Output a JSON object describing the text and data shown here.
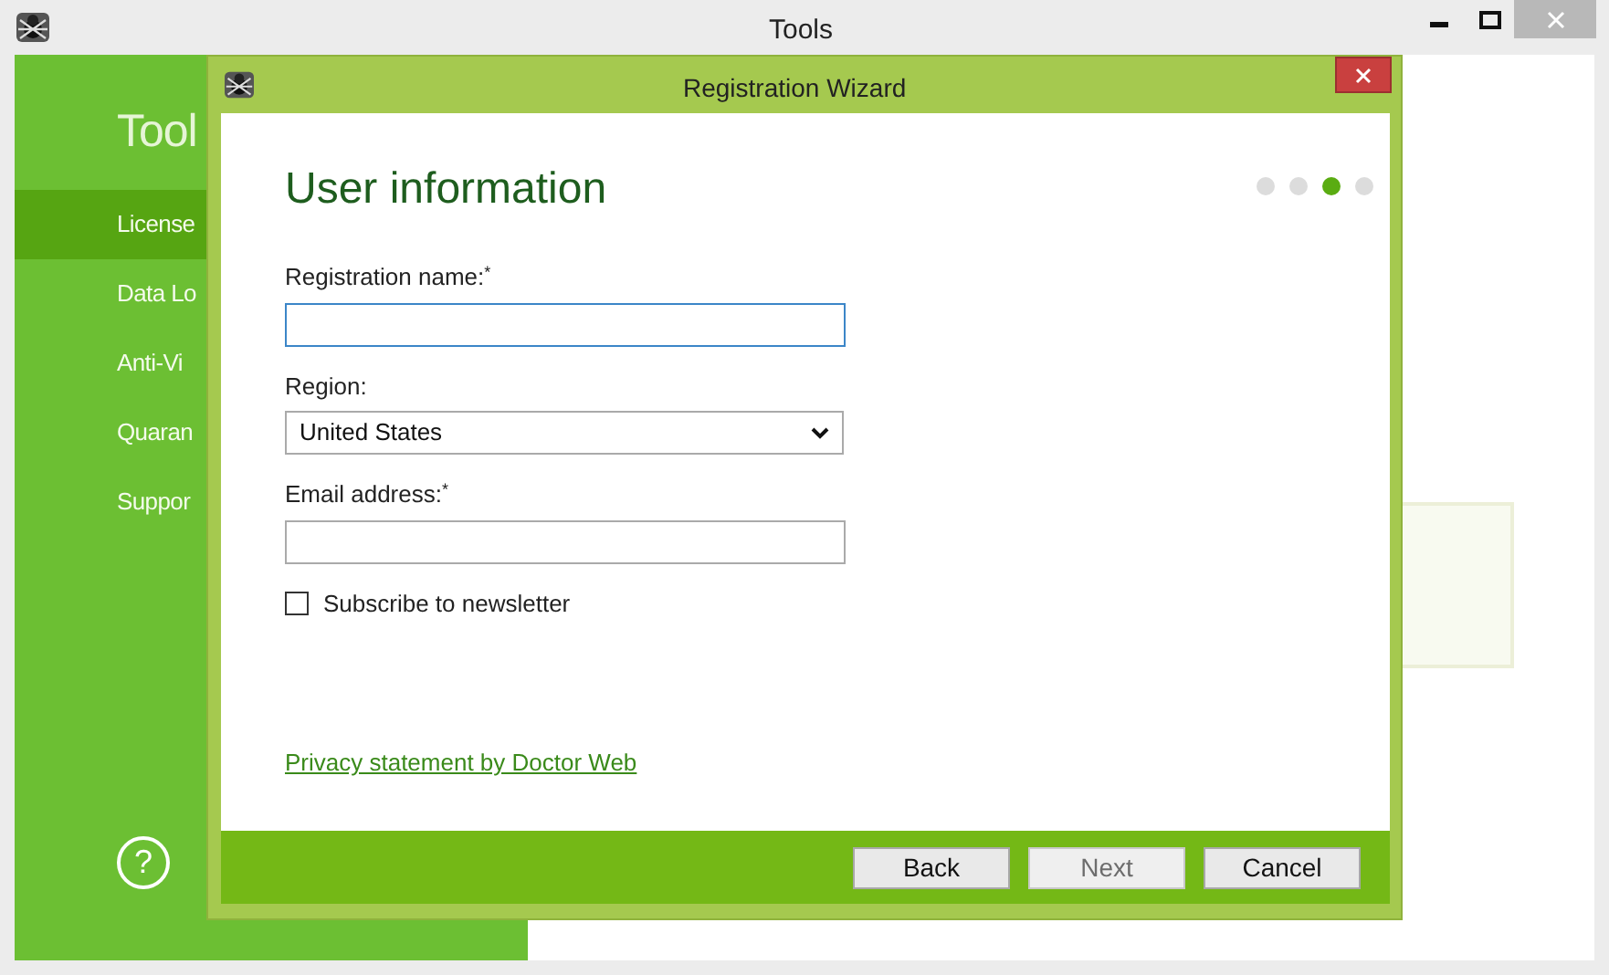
{
  "window": {
    "title": "Tools"
  },
  "sidebar": {
    "title": "Tool",
    "items": [
      {
        "label": "License",
        "selected": true
      },
      {
        "label": "Data Lo",
        "selected": false
      },
      {
        "label": "Anti-Vi",
        "selected": false
      },
      {
        "label": "Quaran",
        "selected": false
      },
      {
        "label": "Suppor",
        "selected": false
      }
    ],
    "help": "?"
  },
  "dialog": {
    "title": "Registration Wizard",
    "heading": "User information",
    "steps": [
      {
        "selected": false
      },
      {
        "selected": false
      },
      {
        "selected": true
      },
      {
        "selected": false
      }
    ],
    "fields": [
      {
        "kind": "text",
        "label": "Registration name:$^{*}$",
        "focused": true
      },
      {
        "kind": "select",
        "label": "Region:",
        "value": "United States"
      },
      {
        "kind": "text",
        "label": "Email address:$^{*}$",
        "focused": false
      }
    ],
    "checkbox": {
      "label": "Subscribe to newsletter",
      "checked": false
    },
    "link": "Privacy statement by Doctor Web",
    "buttons": [
      {
        "label": "Back",
        "disabled": false
      },
      {
        "label": "Next",
        "disabled": true
      },
      {
        "label": "Cancel",
        "disabled": false
      }
    ]
  }
}
